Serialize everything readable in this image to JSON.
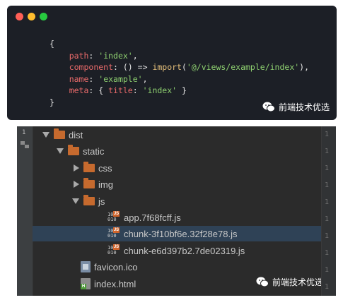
{
  "code_card": {
    "window_dots": [
      "#ff5f56",
      "#ffbd2e",
      "#27c93f"
    ],
    "lines": {
      "open": "{",
      "path_key": "path",
      "path_value": "'index'",
      "component_key": "component",
      "component_arrow": "() =>",
      "component_fn": "import",
      "component_arg": "'@/views/example/index'",
      "name_key": "name",
      "name_value": "'example'",
      "meta_key": "meta",
      "meta_title_key": "title",
      "meta_title_value": "'index'",
      "close": "}"
    },
    "watermark": "前端技术优选"
  },
  "tree": {
    "strip_number": "1",
    "gutter_numbers": [
      "1",
      "1",
      "1",
      "1",
      "1",
      "1",
      "1",
      "1",
      "1",
      "1"
    ],
    "items": [
      {
        "label": "dist",
        "type": "folder",
        "expanded": true
      },
      {
        "label": "static",
        "type": "folder",
        "expanded": true
      },
      {
        "label": "css",
        "type": "folder",
        "expanded": false
      },
      {
        "label": "img",
        "type": "folder",
        "expanded": false
      },
      {
        "label": "js",
        "type": "folder",
        "expanded": true
      },
      {
        "label": "app.7f68fcff.js",
        "type": "js"
      },
      {
        "label": "chunk-3f10bf6e.32f28e78.js",
        "type": "js",
        "selected": true
      },
      {
        "label": "chunk-e6d397b2.7de02319.js",
        "type": "js"
      },
      {
        "label": "favicon.ico",
        "type": "ico"
      },
      {
        "label": "index.html",
        "type": "html"
      }
    ],
    "js_badge": "JS",
    "js_binary": "10\n010",
    "watermark": "前端技术优选"
  },
  "colors": {
    "folder": "#c66a2e",
    "selection": "#2f4256",
    "code_string": "#8ed070",
    "code_property": "#e96a6a"
  }
}
